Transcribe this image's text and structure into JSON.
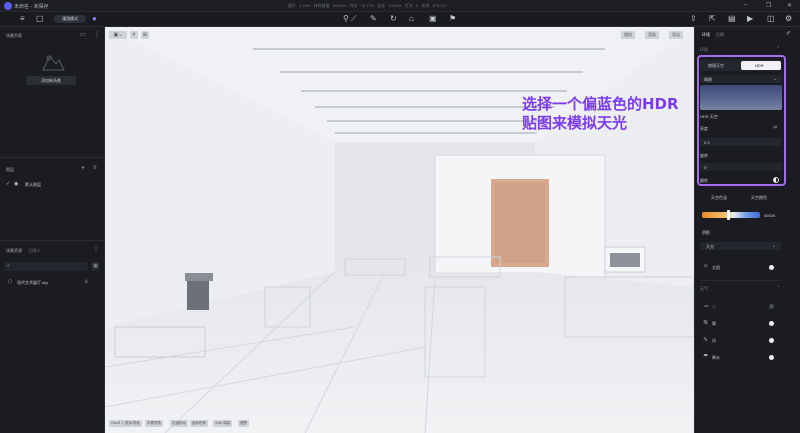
{
  "app": {
    "title": "未命名 - 未保存",
    "stats": "面片 3.24% 材料数量 34.63% 内存 78.17% 显存 100.0% 灯光 0 实例 875,037"
  },
  "toolbar": {
    "mode_label": "漫游模式"
  },
  "left_panel": {
    "scene_list_header": "场景列表",
    "add_scene_button": "添加新场景",
    "layers_header": "图层",
    "default_layer": "默认图层",
    "assets_header": "场景资源",
    "imported_tab": "已导入",
    "asset_file": "现代艺术展厅.skp"
  },
  "viewport": {
    "chips": [
      "GeoR ⇧ 鼠标/导航",
      "平移视角",
      "右键拖动",
      "旋转视角",
      "Shift 调高",
      "视野"
    ],
    "top_buttons": [
      "相机",
      "渲染",
      "导出"
    ]
  },
  "annotation": {
    "line1": "选择一个偏蓝色的HDR",
    "line2": "贴图来模拟天光"
  },
  "right_panel": {
    "tabs": [
      "环境",
      "后期"
    ],
    "section_env": "环境",
    "sky_tabs": [
      "物理天空",
      "HDR"
    ],
    "hdr_select": "晴朗",
    "hdr_sky_label": "HDR 天空",
    "brightness_label": "亮度",
    "brightness_value": "0.5",
    "rotation_label": "旋转",
    "rotation_value": "0°",
    "flip_label": "翻转",
    "sky_color_tabs": [
      "天空色温",
      "天空颜色"
    ],
    "color_temp": "6500K",
    "shadow_label": "阴影",
    "shadow_select": "天光",
    "sun_label": "太阳",
    "weather_header": "天气",
    "weather_items": [
      "云",
      "雾",
      "风",
      "降水"
    ]
  }
}
